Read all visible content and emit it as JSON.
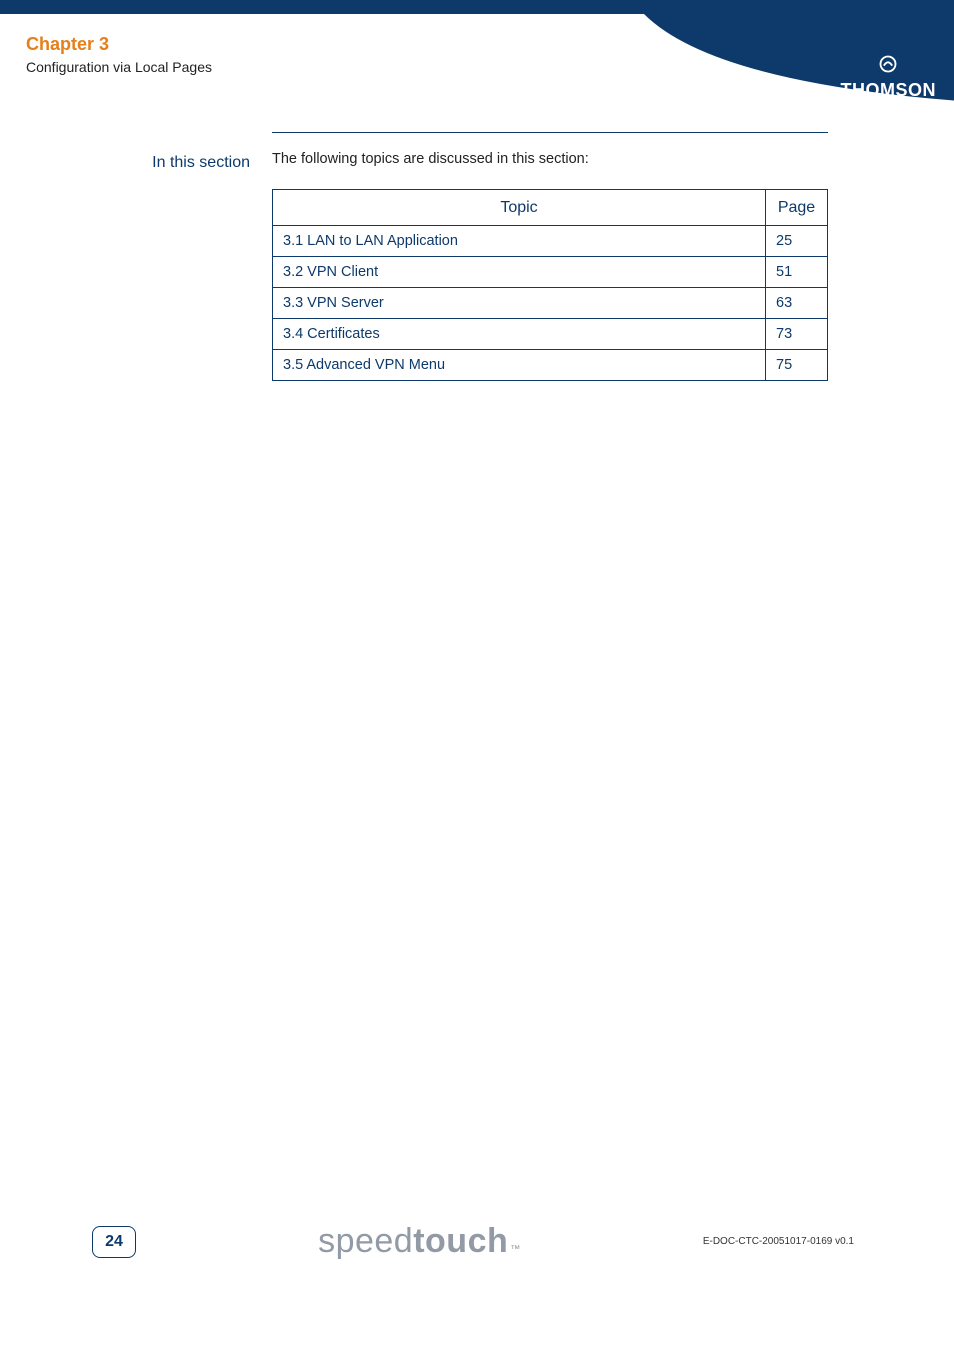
{
  "header": {
    "chapter_title": "Chapter 3",
    "chapter_sub": "Configuration via Local Pages",
    "brand": "THOMSON"
  },
  "section": {
    "side_label": "In this section",
    "intro": "The following topics are discussed in this section:",
    "table": {
      "header_topic": "Topic",
      "header_page": "Page",
      "rows": [
        {
          "topic": "3.1 LAN to LAN Application",
          "page": "25"
        },
        {
          "topic": "3.2 VPN Client",
          "page": "51"
        },
        {
          "topic": "3.3 VPN Server",
          "page": "63"
        },
        {
          "topic": "3.4 Certificates",
          "page": "73"
        },
        {
          "topic": "3.5 Advanced VPN Menu",
          "page": "75"
        }
      ]
    }
  },
  "footer": {
    "page_number": "24",
    "logo_light": "speed",
    "logo_bold": "touch",
    "logo_tm": "™",
    "doc_id": "E-DOC-CTC-20051017-0169 v0.1"
  }
}
